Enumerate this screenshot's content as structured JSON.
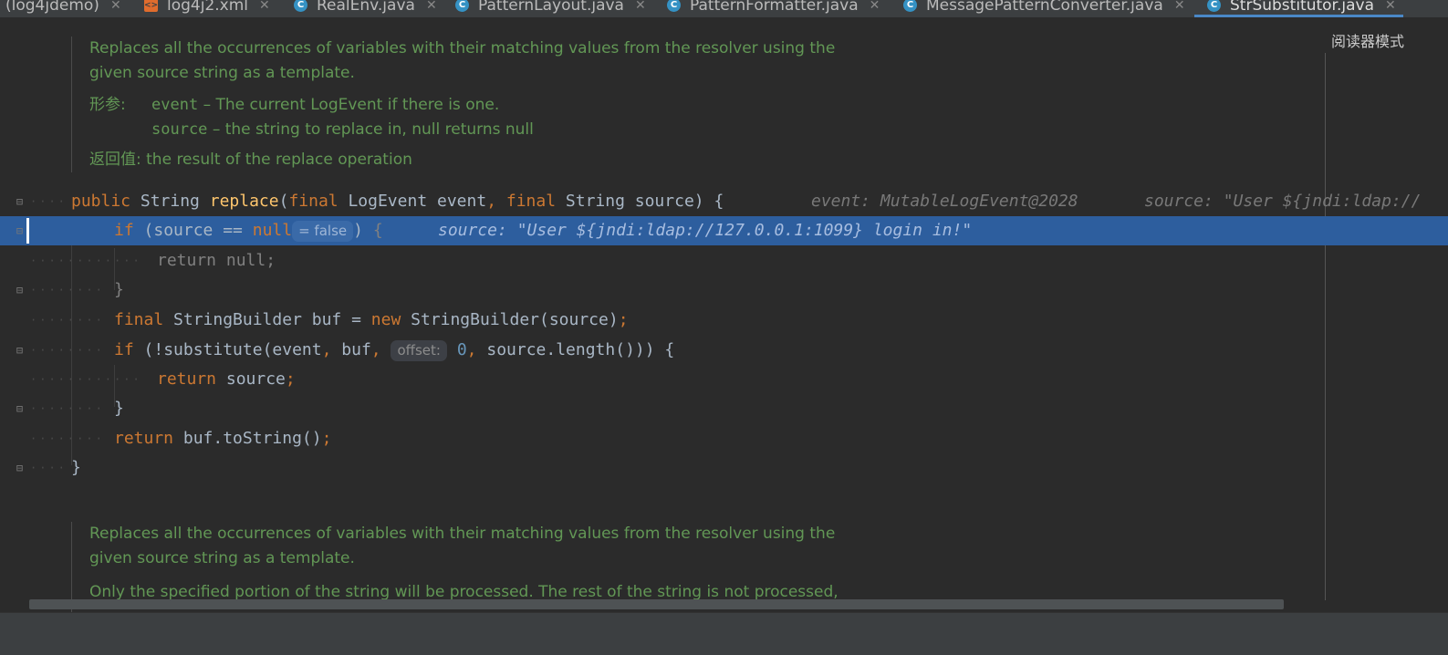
{
  "tabs": [
    {
      "label": "(log4jdemo)",
      "icon": "none"
    },
    {
      "label": "log4j2.xml",
      "icon": "xml-file-icon"
    },
    {
      "label": "RealEnv.java",
      "icon": "class-icon"
    },
    {
      "label": "PatternLayout.java",
      "icon": "class-icon"
    },
    {
      "label": "PatternFormatter.java",
      "icon": "class-icon"
    },
    {
      "label": "MessagePatternConverter.java",
      "icon": "class-icon"
    },
    {
      "label": "StrSubstitutor.java",
      "icon": "class-icon",
      "active": true
    }
  ],
  "reader_mode": "阅读器模式",
  "doc1": {
    "line1": "Replaces all the occurrences of variables with their matching values from the resolver using the",
    "line2": "given source string as a template.",
    "params_label": "形参:",
    "param1_name": "event",
    "param1_desc": " – The current LogEvent if there is one.",
    "param2_name": "source",
    "param2_desc": " – the string to replace in, null returns null",
    "returns_label": "返回值:",
    "returns_desc": "the result of the replace operation"
  },
  "code": {
    "l1": {
      "public": "public",
      "type": " String ",
      "name": "replace",
      "open": "(",
      "final1": "final",
      "p1": " LogEvent event",
      "comma1": ",",
      "sp": " ",
      "final2": "final",
      "p2": " String source) {",
      "hint1": "event: MutableLogEvent@2028",
      "hint2": "source: \"User ${jndi:ldap://"
    },
    "l2": {
      "if": "if",
      "cond": " (source == ",
      "null": "null",
      "pill": "= false",
      "close": ") ",
      "brace": "{",
      "hint": "source: \"User ${jndi:ldap://127.0.0.1:1099} login in!\""
    },
    "l3": {
      "text": "return null;"
    },
    "l4": {
      "text": "}"
    },
    "l5": {
      "final": "final",
      "mid": " StringBuilder buf = ",
      "new": "new",
      "rest": " StringBuilder(source)",
      "semi": ";"
    },
    "l6": {
      "if": "if",
      "a": " (!substitute(event",
      "c1": ",",
      "b": " buf",
      "c2": ",",
      "pill": "offset:",
      "num": "0",
      "c3": ",",
      "d": " source.length())) {"
    },
    "l7": {
      "return": "return",
      "rest": " source",
      "semi": ";"
    },
    "l8": {
      "text": "}"
    },
    "l9": {
      "return": "return",
      "rest": " buf.toString()",
      "semi": ";"
    },
    "l10": {
      "text": "}"
    }
  },
  "doc2": {
    "line1": "Replaces all the occurrences of variables with their matching values from the resolver using the",
    "line2": "given source string as a template.",
    "line3": "Only the specified portion of the string will be processed. The rest of the string is not processed,"
  },
  "colors": {
    "keyword": "#cc7832",
    "method": "#ffc66d",
    "number": "#6897bb",
    "doc": "#629755",
    "highlight": "#2d5e9e",
    "background": "#2b2b2b"
  }
}
